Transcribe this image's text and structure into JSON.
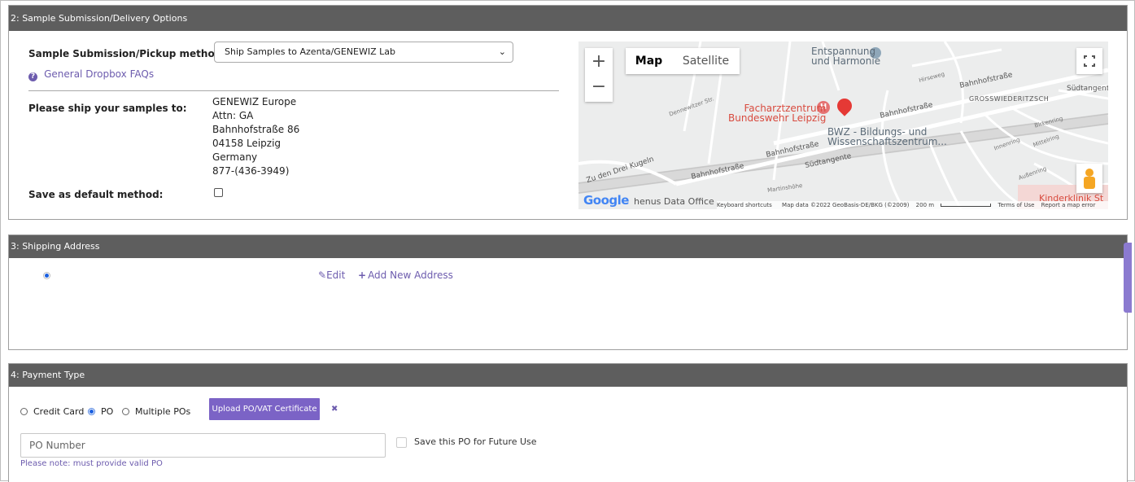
{
  "section2": {
    "header": "2: Sample Submission/Delivery Options",
    "method_label": "Sample Submission/Pickup method:",
    "faq_link": "General Dropbox FAQs",
    "method_value": "Ship Samples to Azenta/GENEWIZ Lab",
    "ship_to_label": "Please ship your samples to:",
    "address": [
      "GENEWIZ Europe",
      "Attn: GA",
      "Bahnhofstraße 86",
      "04158 Leipzig",
      "Germany",
      "877-(436-3949)"
    ],
    "default_label": "Save as default method:",
    "map": {
      "map_tab": "Map",
      "satellite_tab": "Satellite",
      "zoom_in": "+",
      "zoom_out": "−",
      "labels": {
        "entspannung": "Entspannung",
        "harmonie": "und Harmonie",
        "facharzt": "Facharztzentrum",
        "bundeswehr": "Bundeswehr Leipzig",
        "bwz1": "BWZ - Bildungs- und",
        "bwz2": "Wissenschaftszentrum...",
        "bahnhof1": "Bahnhofstraße",
        "bahnhof2": "Bahnhofstraße",
        "bahnhof3": "Bahnhofstraße",
        "bahnhof4": "Bahnhofstraße",
        "grosswieder": "GROSSWIEDERITZSCH",
        "suedtangente1": "Südtangente",
        "suedtangente2": "Südtangent",
        "drei_kugeln": "Zu den Drei Kugeln",
        "kinderklinik": "Kinderklinik St",
        "henus": "henus Data Office",
        "hirseweg": "Hirseweg",
        "birkenring": "Birkenring",
        "innenring": "Innenring",
        "mittelring": "Mittelring",
        "aussenring": "Außenring",
        "martinshoehe": "Martinshöhe",
        "dennewitzer": "Dennewitzer Str."
      },
      "google": "Google",
      "keyboard": "Keyboard shortcuts",
      "map_data": "Map data ©2022 GeoBasis-DE/BKG (©2009)",
      "scale": "200 m",
      "terms": "Terms of Use",
      "report": "Report a map error"
    }
  },
  "section3": {
    "header": "3: Shipping Address",
    "edit": "Edit",
    "add_new": "Add New Address"
  },
  "section4": {
    "header": "4: Payment Type",
    "credit_card": "Credit Card",
    "po": "PO",
    "multiple_pos": "Multiple POs",
    "upload": "Upload PO/VAT Certificate",
    "remove": "✖",
    "po_placeholder": "PO Number",
    "save_po": "Save this PO for Future Use",
    "note": "Please note: must provide valid PO"
  },
  "colors": {
    "header_bg": "#5e5e5e",
    "accent": "#7b63c6",
    "link": "#6d5cae",
    "map_pin": "#e53935"
  }
}
